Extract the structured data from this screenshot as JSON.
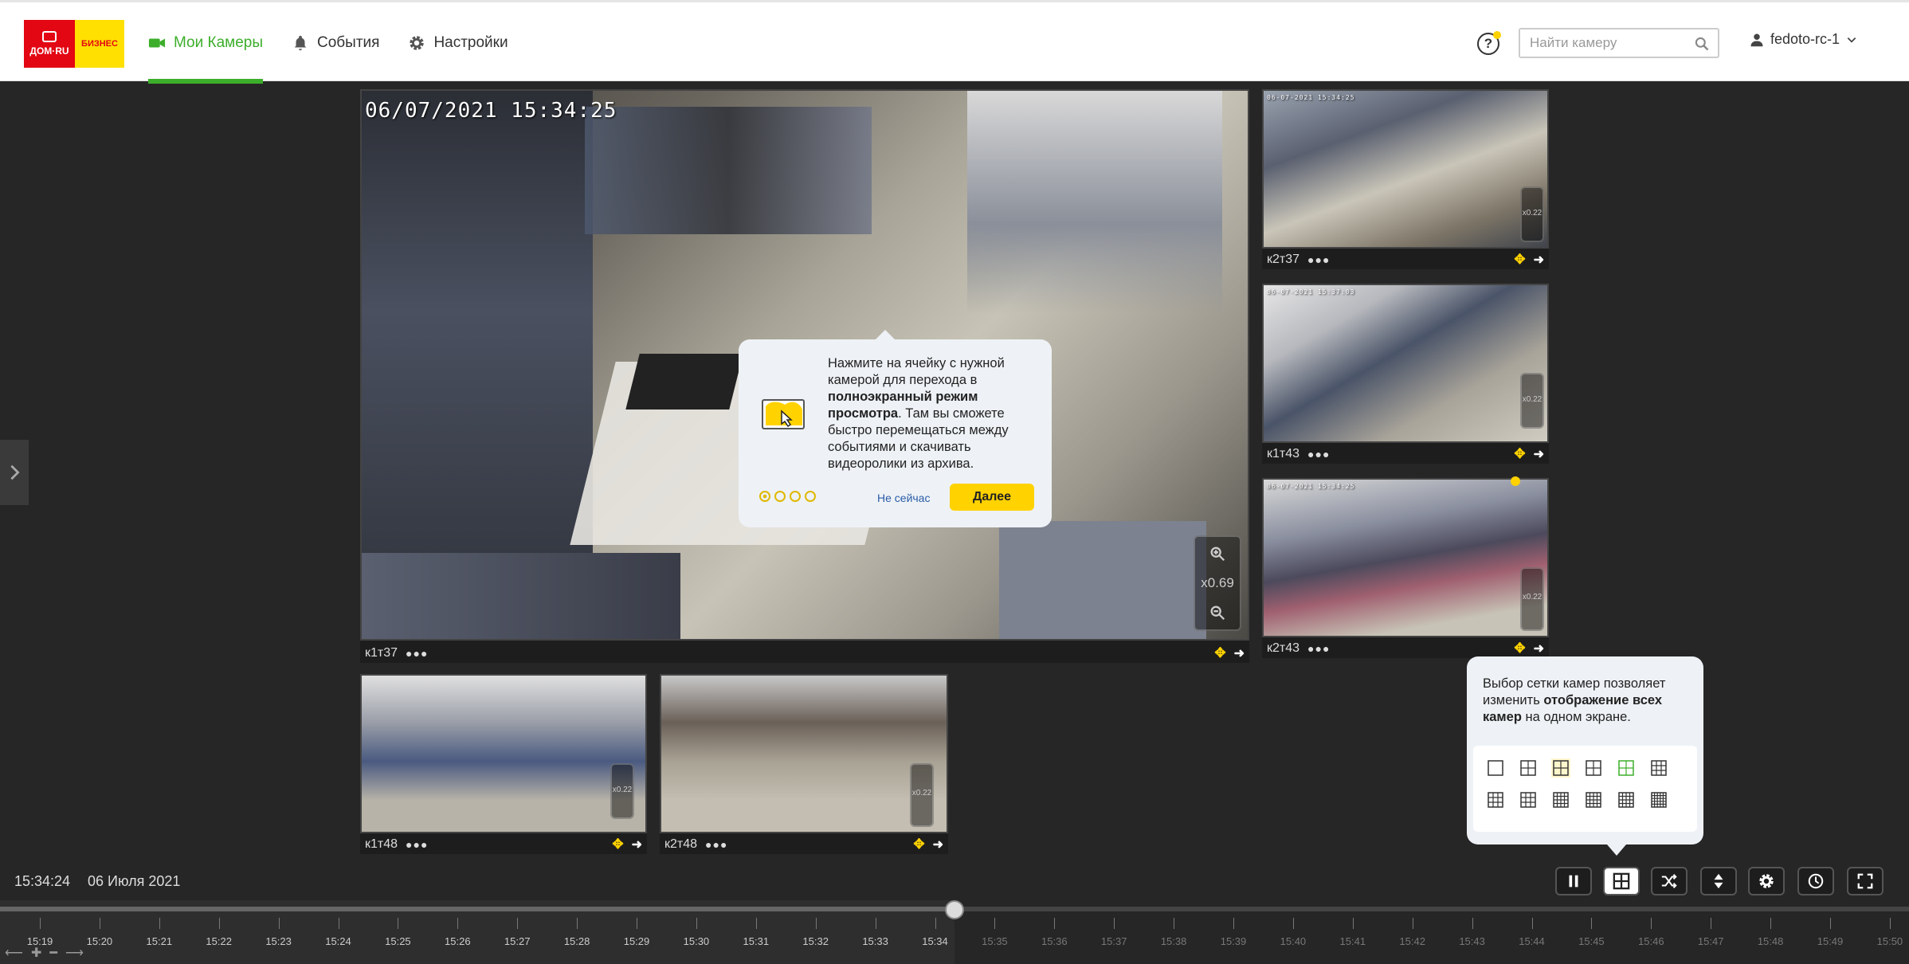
{
  "header": {
    "logo": {
      "line1": "ДОМ·RU",
      "line2": "БИЗНЕС"
    },
    "nav": [
      {
        "label": "Мои Камеры",
        "icon": "video-camera-icon",
        "active": true
      },
      {
        "label": "События",
        "icon": "bell-icon",
        "active": false
      },
      {
        "label": "Настройки",
        "icon": "gear-icon",
        "active": false
      }
    ],
    "search_placeholder": "Найти камеру",
    "username": "fedoto-rc-1"
  },
  "cameras": [
    {
      "name": "к1т37",
      "timestamp": "06/07/2021 15:34:25",
      "zoom": "x0.69"
    },
    {
      "name": "к2т37",
      "timestamp": "06-07-2021 15:34:25",
      "zoom": "x0.22"
    },
    {
      "name": "к1т43",
      "timestamp": "06-07-2021 15:37:03",
      "zoom": "x0.22"
    },
    {
      "name": "к2т43",
      "timestamp": "06-07-2021 15:34:25",
      "zoom": "x0.22"
    },
    {
      "name": "к1т48",
      "timestamp": "",
      "zoom": "x0.22"
    },
    {
      "name": "к2т48",
      "timestamp": "",
      "zoom": "x0.22"
    }
  ],
  "tip_fullscreen": {
    "text_a": "Нажмите на ячейку с нужной камерой для перехода в ",
    "text_bold": "полноэкранный режим просмотра",
    "text_b": ". Там вы сможете быстро перемещаться между событиями и скачивать видеоролики из архива.",
    "later": "Не сейчас",
    "next": "Далее"
  },
  "tip_grid": {
    "text_a": "Выбор сетки камер позволяет изменить ",
    "text_bold": "отображение всех камер",
    "text_b": " на одном экране."
  },
  "playback": {
    "time": "15:34:24",
    "date": "06 Июля 2021",
    "progress": 0.5
  },
  "timeline": {
    "ticks": [
      "15:19",
      "15:20",
      "15:21",
      "15:22",
      "15:23",
      "15:24",
      "15:25",
      "15:26",
      "15:27",
      "15:28",
      "15:29",
      "15:30",
      "15:31",
      "15:32",
      "15:33",
      "15:34",
      "15:35",
      "15:36",
      "15:37",
      "15:38",
      "15:39",
      "15:40",
      "15:41",
      "15:42",
      "15:43",
      "15:44",
      "15:45",
      "15:46",
      "15:47",
      "15:48",
      "15:49",
      "15:50"
    ],
    "current_index": 15
  },
  "colors": {
    "accent": "#3dae2b",
    "brand_red": "#e30613",
    "brand_yellow": "#ffd200"
  }
}
